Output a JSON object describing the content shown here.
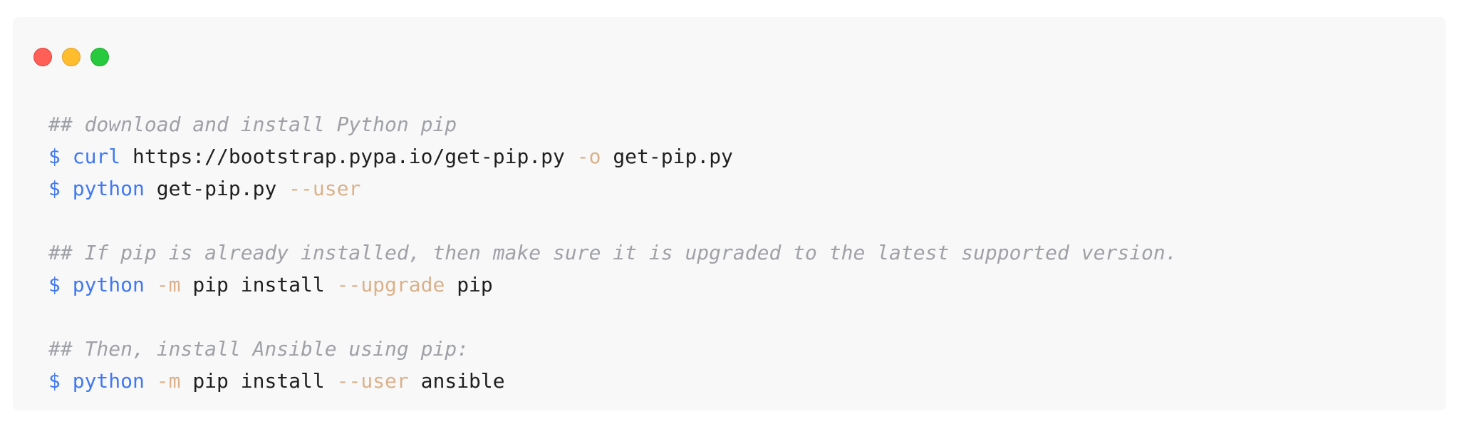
{
  "window": {
    "controls": [
      {
        "name": "close",
        "color": "#ff5f56"
      },
      {
        "name": "minimize",
        "color": "#ffbd2e"
      },
      {
        "name": "maximize",
        "color": "#27c93f"
      }
    ]
  },
  "code": {
    "comment1": "## download and install Python pip",
    "line1": {
      "prompt": "$",
      "cmd": "curl",
      "arg1": "https://bootstrap.pypa.io/get-pip.py",
      "flag": "-o",
      "arg2": "get-pip.py"
    },
    "line2": {
      "prompt": "$",
      "cmd": "python",
      "arg1": "get-pip.py",
      "flag": "--user"
    },
    "comment2": "## If pip is already installed, then make sure it is upgraded to the latest supported version.",
    "line3": {
      "prompt": "$",
      "cmd": "python",
      "flag1": "-m",
      "arg1": "pip install",
      "flag2": "--upgrade",
      "arg2": "pip"
    },
    "comment3": "## Then, install Ansible using pip:",
    "line4": {
      "prompt": "$",
      "cmd": "python",
      "flag1": "-m",
      "arg1": "pip install",
      "flag2": "--user",
      "arg2": "ansible"
    }
  },
  "colors": {
    "background": "#f8f8f8",
    "comment": "#a0a1a7",
    "command": "#4078f2",
    "flag": "#d19a66",
    "text": "#1f1f1f"
  }
}
